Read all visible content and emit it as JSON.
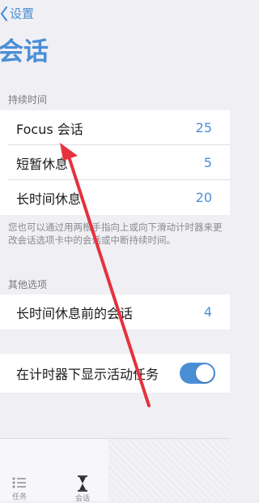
{
  "nav": {
    "back_label": "设置",
    "title": "会话"
  },
  "sections": {
    "duration_header": "持续时间",
    "duration_rows": [
      {
        "label": "Focus 会话",
        "value": "25"
      },
      {
        "label": "短暂休息",
        "value": "5"
      },
      {
        "label": "长时间休息",
        "value": "20"
      }
    ],
    "duration_footer": "您也可以通过用两根手指向上或向下滑动计时器来更改会话选项卡中的会话或中断持续时间。",
    "other_header": "其他选项",
    "sessions_before_long_break": {
      "label": "长时间休息前的会话",
      "value": "4"
    },
    "show_active_task": {
      "label": "在计时器下显示活动任务",
      "enabled": true
    }
  },
  "tabbar": {
    "tabs": [
      {
        "label": "任务",
        "icon": "list-icon"
      },
      {
        "label": "会话",
        "icon": "hourglass-icon"
      }
    ]
  },
  "colors": {
    "accent": "#4a8fd6",
    "annotation_arrow": "#e5323e"
  }
}
